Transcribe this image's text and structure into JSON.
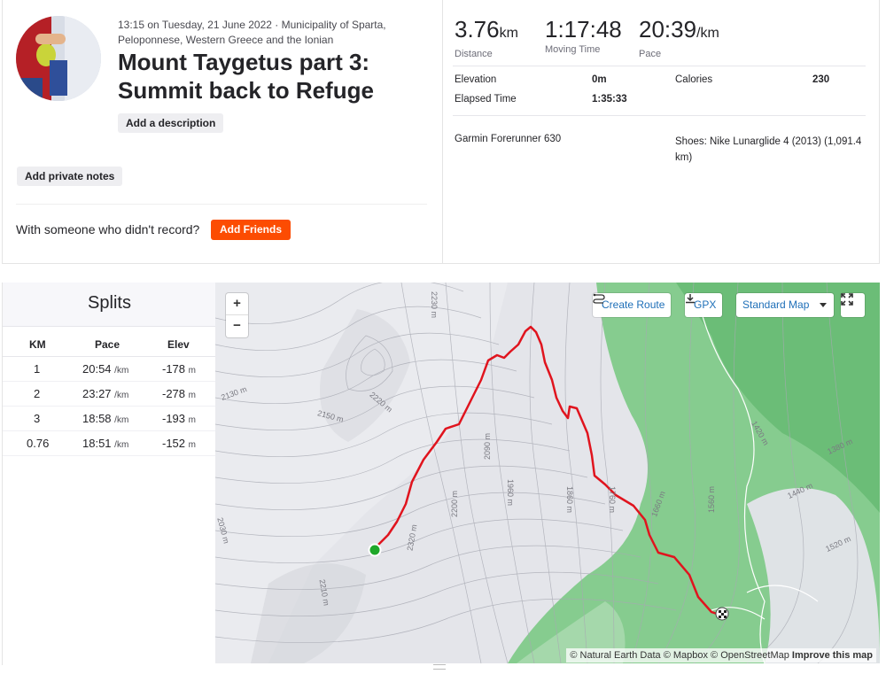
{
  "activity": {
    "datetime": "13:15 on Tuesday, 21 June 2022 · Municipality of Sparta, Peloponnese, Western Greece and the Ionian",
    "title": "Mount Taygetus part 3: Summit back to Refuge",
    "add_description_label": "Add a description",
    "add_private_notes_label": "Add private notes",
    "with_someone_text": "With someone who didn't record?",
    "add_friends_label": "Add Friends"
  },
  "stats": {
    "distance": {
      "value": "3.76",
      "unit": "km",
      "label": "Distance"
    },
    "moving_time": {
      "value": "1:17:48",
      "label": "Moving Time"
    },
    "pace": {
      "value": "20:39",
      "unit": "/km",
      "label": "Pace"
    },
    "elevation_label": "Elevation",
    "elevation_value": "0m",
    "calories_label": "Calories",
    "calories_value": "230",
    "elapsed_label": "Elapsed Time",
    "elapsed_value": "1:35:33",
    "device": "Garmin Forerunner 630",
    "shoes_line1": "Shoes: Nike Lunarglide 4 (2013) (1,091.4",
    "shoes_line2": "km)"
  },
  "splits": {
    "title": "Splits",
    "headers": {
      "km": "KM",
      "pace": "Pace",
      "elev": "Elev"
    },
    "rows": [
      {
        "km": "1",
        "pace": "20:54",
        "pace_unit": "/km",
        "elev": "-178",
        "elev_unit": "m"
      },
      {
        "km": "2",
        "pace": "23:27",
        "pace_unit": "/km",
        "elev": "-278",
        "elev_unit": "m"
      },
      {
        "km": "3",
        "pace": "18:58",
        "pace_unit": "/km",
        "elev": "-193",
        "elev_unit": "m"
      },
      {
        "km": "0.76",
        "pace": "18:51",
        "pace_unit": "/km",
        "elev": "-152",
        "elev_unit": "m"
      }
    ]
  },
  "map": {
    "zoom_in": "+",
    "zoom_out": "−",
    "create_route_label": "Create Route",
    "gpx_label": "GPX",
    "standard_map_label": "Standard Map",
    "attribution": "© Natural Earth Data © Mapbox © OpenStreetMap",
    "improve_label": "Improve this map",
    "contour_labels": [
      "2230 m",
      "2130 m",
      "2150 m",
      "2220 m",
      "2090 m",
      "2200 m",
      "1960 m",
      "1860 m",
      "1760 m",
      "1660 m",
      "1560 m",
      "1420 m",
      "1380 m",
      "1440 m",
      "1520 m",
      "2030 m",
      "2320 m",
      "2210 m"
    ],
    "colors": {
      "route": "#e0141e",
      "start": "#1fa82a",
      "forest": "#7fc98a",
      "terrain": "#e4e5ea"
    }
  },
  "icons": {
    "create_route": "route-icon",
    "gpx": "download-icon",
    "standard_map": "caret-down-icon",
    "fullscreen": "fullscreen-icon"
  }
}
